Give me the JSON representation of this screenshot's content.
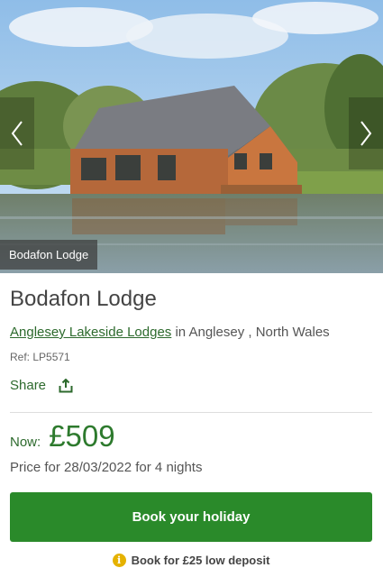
{
  "gallery": {
    "caption": "Bodafon Lodge"
  },
  "property": {
    "title": "Bodafon Lodge",
    "park_link": "Anglesey Lakeside Lodges",
    "location_text": "in Anglesey , North Wales",
    "ref": "Ref: LP5571"
  },
  "share": {
    "label": "Share",
    "icon": "share-icon"
  },
  "pricing": {
    "now_label": "Now:",
    "price": "£509",
    "note": "Price for 28/03/2022 for 4 nights"
  },
  "actions": {
    "book_label": "Book your holiday",
    "deposit_text": "Book for £25 low deposit",
    "deposit_icon": "info-icon"
  },
  "colors": {
    "brand_green": "#2a8a2a",
    "link_green": "#2d6a2d",
    "info_yellow": "#e5b200"
  }
}
